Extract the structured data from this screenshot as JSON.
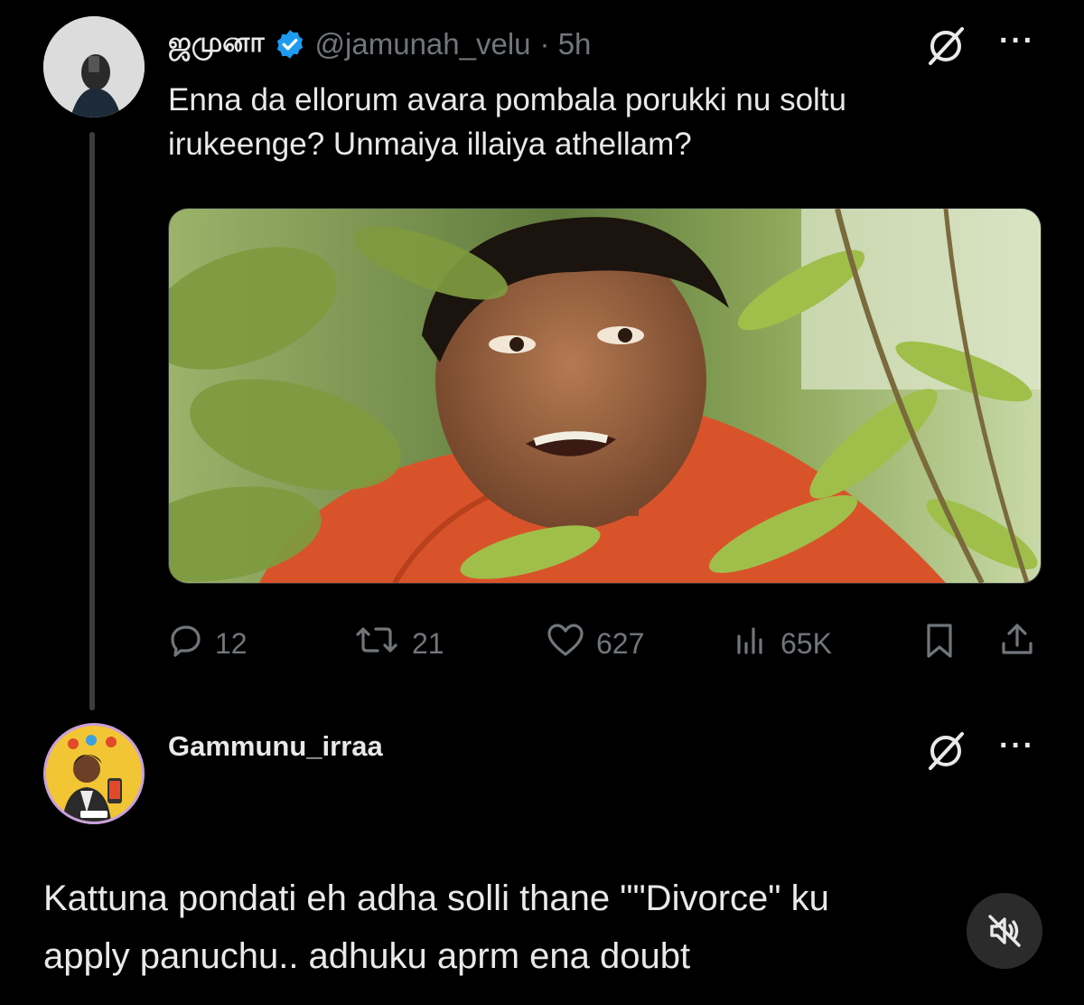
{
  "tweet": {
    "display_name": "ஜமுனா",
    "handle": "@jamunah_velu",
    "time": "· 5h",
    "text_line1": "Enna da ellorum avara pombala porukki nu soltu",
    "text_line2": "irukeenge? Unmaiya illaiya athellam?",
    "actions": {
      "replies": "12",
      "reposts": "21",
      "likes": "627",
      "views": "65K"
    }
  },
  "reply": {
    "display_name": "Gammunu_irraa",
    "text_line1": "Kattuna pondati eh adha solli thane \"\"Divorce\" ku",
    "text_line2": "apply panuchu.. adhuku aprm ena doubt"
  },
  "more_label": "···",
  "colors": {
    "background": "#000000",
    "text": "#e7e9ea",
    "muted": "#71767b",
    "verified": "#1d9bf0",
    "avatar_ring": "#c9a0dc"
  },
  "icons": [
    "grok-icon",
    "more-icon",
    "reply-icon",
    "repost-icon",
    "like-icon",
    "views-icon",
    "bookmark-icon",
    "share-icon",
    "verified-badge-icon",
    "mute-icon"
  ]
}
